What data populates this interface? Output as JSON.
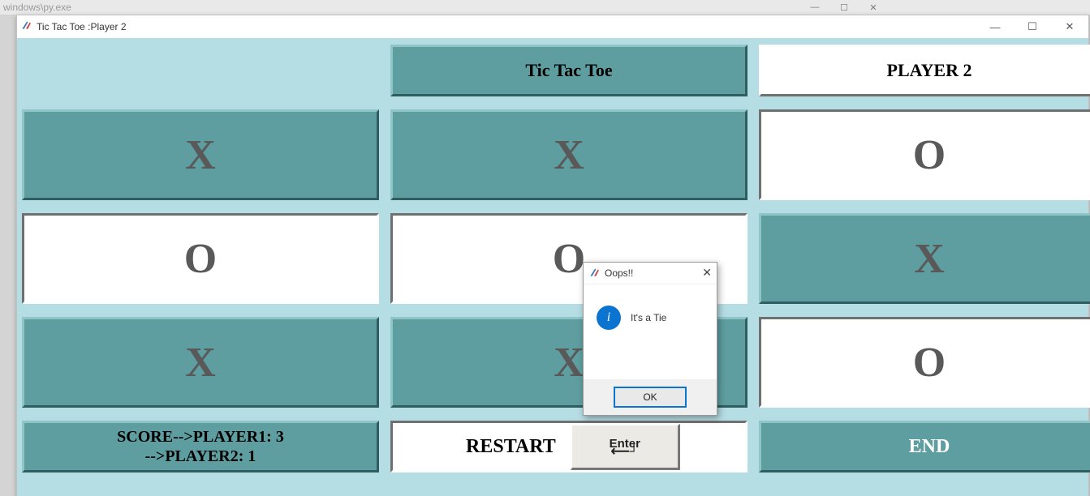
{
  "parent_window": {
    "path": "windows\\py.exe"
  },
  "window": {
    "title": "Tic Tac Toe :Player 2",
    "controls": {
      "min": "—",
      "max": "☐",
      "close": "✕"
    }
  },
  "header": {
    "game_title": "Tic Tac Toe",
    "player_banner": "PLAYER 2"
  },
  "board": {
    "cells": [
      "X",
      "X",
      "O",
      "O",
      "O",
      "X",
      "X",
      "X",
      "O"
    ],
    "pressed": [
      true,
      true,
      false,
      false,
      false,
      true,
      true,
      true,
      false
    ]
  },
  "footer": {
    "score_line1": "SCORE-->PLAYER1: 3",
    "score_line2": "-->PLAYER2: 1",
    "restart_label": "RESTART",
    "enter_label": "Enter",
    "end_label": "END"
  },
  "dialog": {
    "title": "Oops!!",
    "message": "It's a Tie",
    "ok": "OK"
  },
  "scores": {
    "player1": 3,
    "player2": 1
  }
}
